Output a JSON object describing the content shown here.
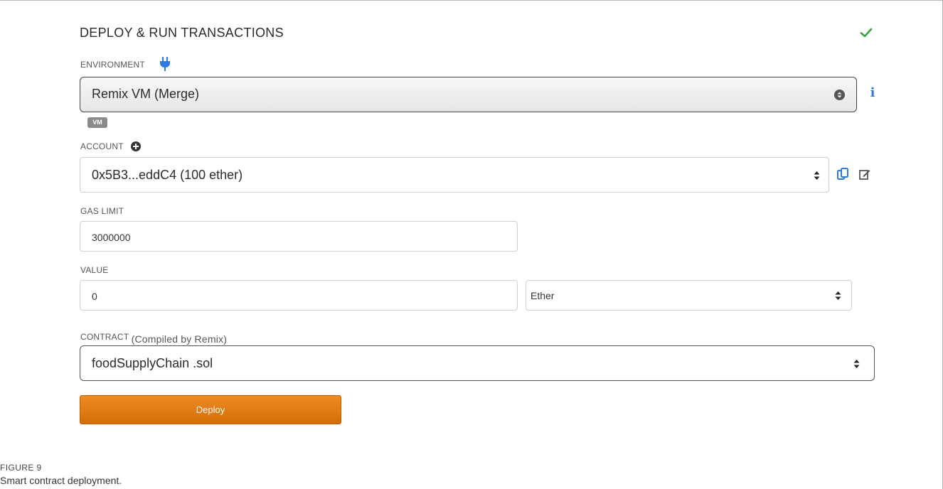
{
  "panel": {
    "title": "DEPLOY & RUN TRANSACTIONS",
    "status_icon": "check-icon",
    "status_color": "#3aa53a"
  },
  "environment": {
    "label": "ENVIRONMENT",
    "icon": "plug-icon",
    "selected": "Remix VM (Merge)",
    "info_icon": "info-icon",
    "badge": "VM"
  },
  "account": {
    "label": "ACCOUNT",
    "add_icon": "plus-circle-icon",
    "selected": "0x5B3...eddC4 (100 ether)",
    "copy_icon": "copy-icon",
    "edit_icon": "edit-icon"
  },
  "gas_limit": {
    "label": "GAS LIMIT",
    "value": "3000000"
  },
  "value": {
    "label": "VALUE",
    "amount": "0",
    "unit": "Ether"
  },
  "contract": {
    "label": "CONTRACT",
    "sub_label": "(Compiled by Remix)",
    "selected": "foodSupplyChain .sol"
  },
  "deploy": {
    "label": "Deploy",
    "color": "#e07a10"
  },
  "figure": {
    "number": "FIGURE 9",
    "caption": "Smart contract deployment."
  },
  "accent_blue": "#2a7ae2"
}
